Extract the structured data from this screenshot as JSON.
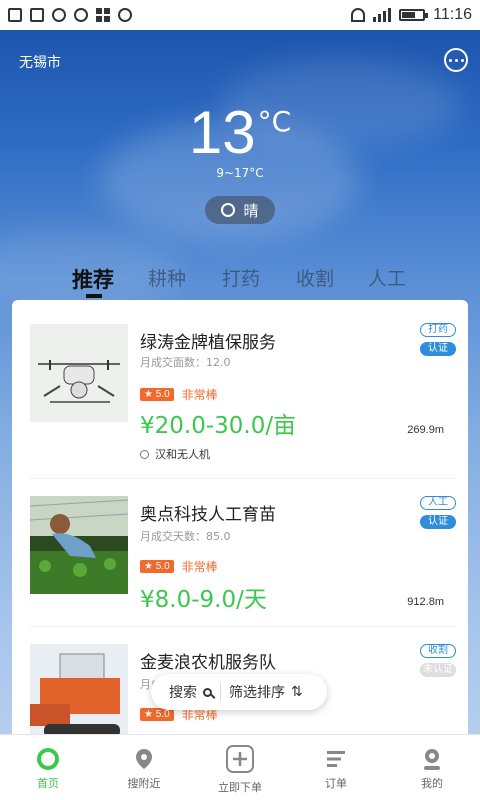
{
  "status_bar": {
    "time": "11:16"
  },
  "header": {
    "city": "无锡市"
  },
  "weather": {
    "temperature": "13",
    "unit": "°C",
    "range": "9~17°C",
    "condition": "晴"
  },
  "tabs": [
    {
      "label": "推荐"
    },
    {
      "label": "耕种"
    },
    {
      "label": "打药"
    },
    {
      "label": "收割"
    },
    {
      "label": "人工"
    }
  ],
  "items": [
    {
      "name": "绿涛金牌植保服务",
      "sub": "月成交面数：12.0",
      "rating": "5.0",
      "rating_text": "非常棒",
      "price": "¥20.0-30.0/亩",
      "provider": "汉和无人机",
      "distance": "269.9m",
      "tag_category": "打药",
      "tag_verified": "认证"
    },
    {
      "name": "奥点科技人工育苗",
      "sub": "月成交天数：85.0",
      "rating": "5.0",
      "rating_text": "非常棒",
      "price": "¥8.0-9.0/天",
      "distance": "912.8m",
      "tag_category": "人工",
      "tag_verified": "认证"
    },
    {
      "name": "金麦浪农机服务队",
      "sub": "月成",
      "rating": "5.0",
      "rating_text": "非常棒",
      "tag_category": "收割",
      "tag_verified": "未认证"
    }
  ],
  "float_bar": {
    "search": "搜索",
    "filter": "筛选排序"
  },
  "bottom_nav": [
    {
      "label": "首页"
    },
    {
      "label": "搜附近"
    },
    {
      "label": "立即下单"
    },
    {
      "label": "订单"
    },
    {
      "label": "我的"
    }
  ],
  "colors": {
    "accent_green": "#3cc84f",
    "tag_blue": "#2f8ddb",
    "rating_orange": "#f2692b"
  }
}
